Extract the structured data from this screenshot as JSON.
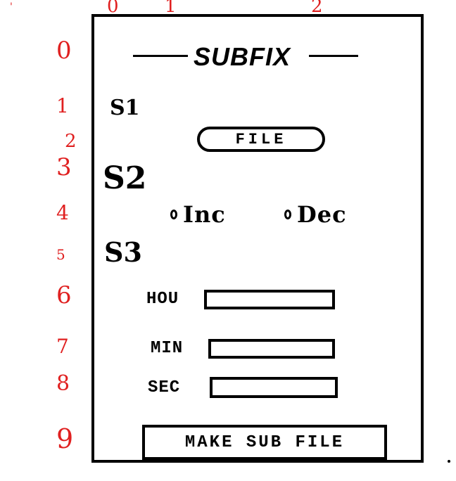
{
  "title": "SUBFIX",
  "column_numbers": [
    "0",
    "1",
    "2"
  ],
  "row_numbers": [
    "0",
    "1",
    "2",
    "3",
    "4",
    "5",
    "6",
    "7",
    "8",
    "9"
  ],
  "corner_mark": "'",
  "sections": {
    "s1": "S1",
    "s2": "S2",
    "s3": "S3"
  },
  "file_button": "FILE",
  "radios": {
    "inc": "Inc",
    "dec": "Dec"
  },
  "fields": {
    "hour_label": "HOU",
    "min_label": "MIN",
    "sec_label": "SEC"
  },
  "make_button": "MAKE SUB FILE",
  "colors": {
    "annotation": "#e02020",
    "ink": "#000000"
  }
}
